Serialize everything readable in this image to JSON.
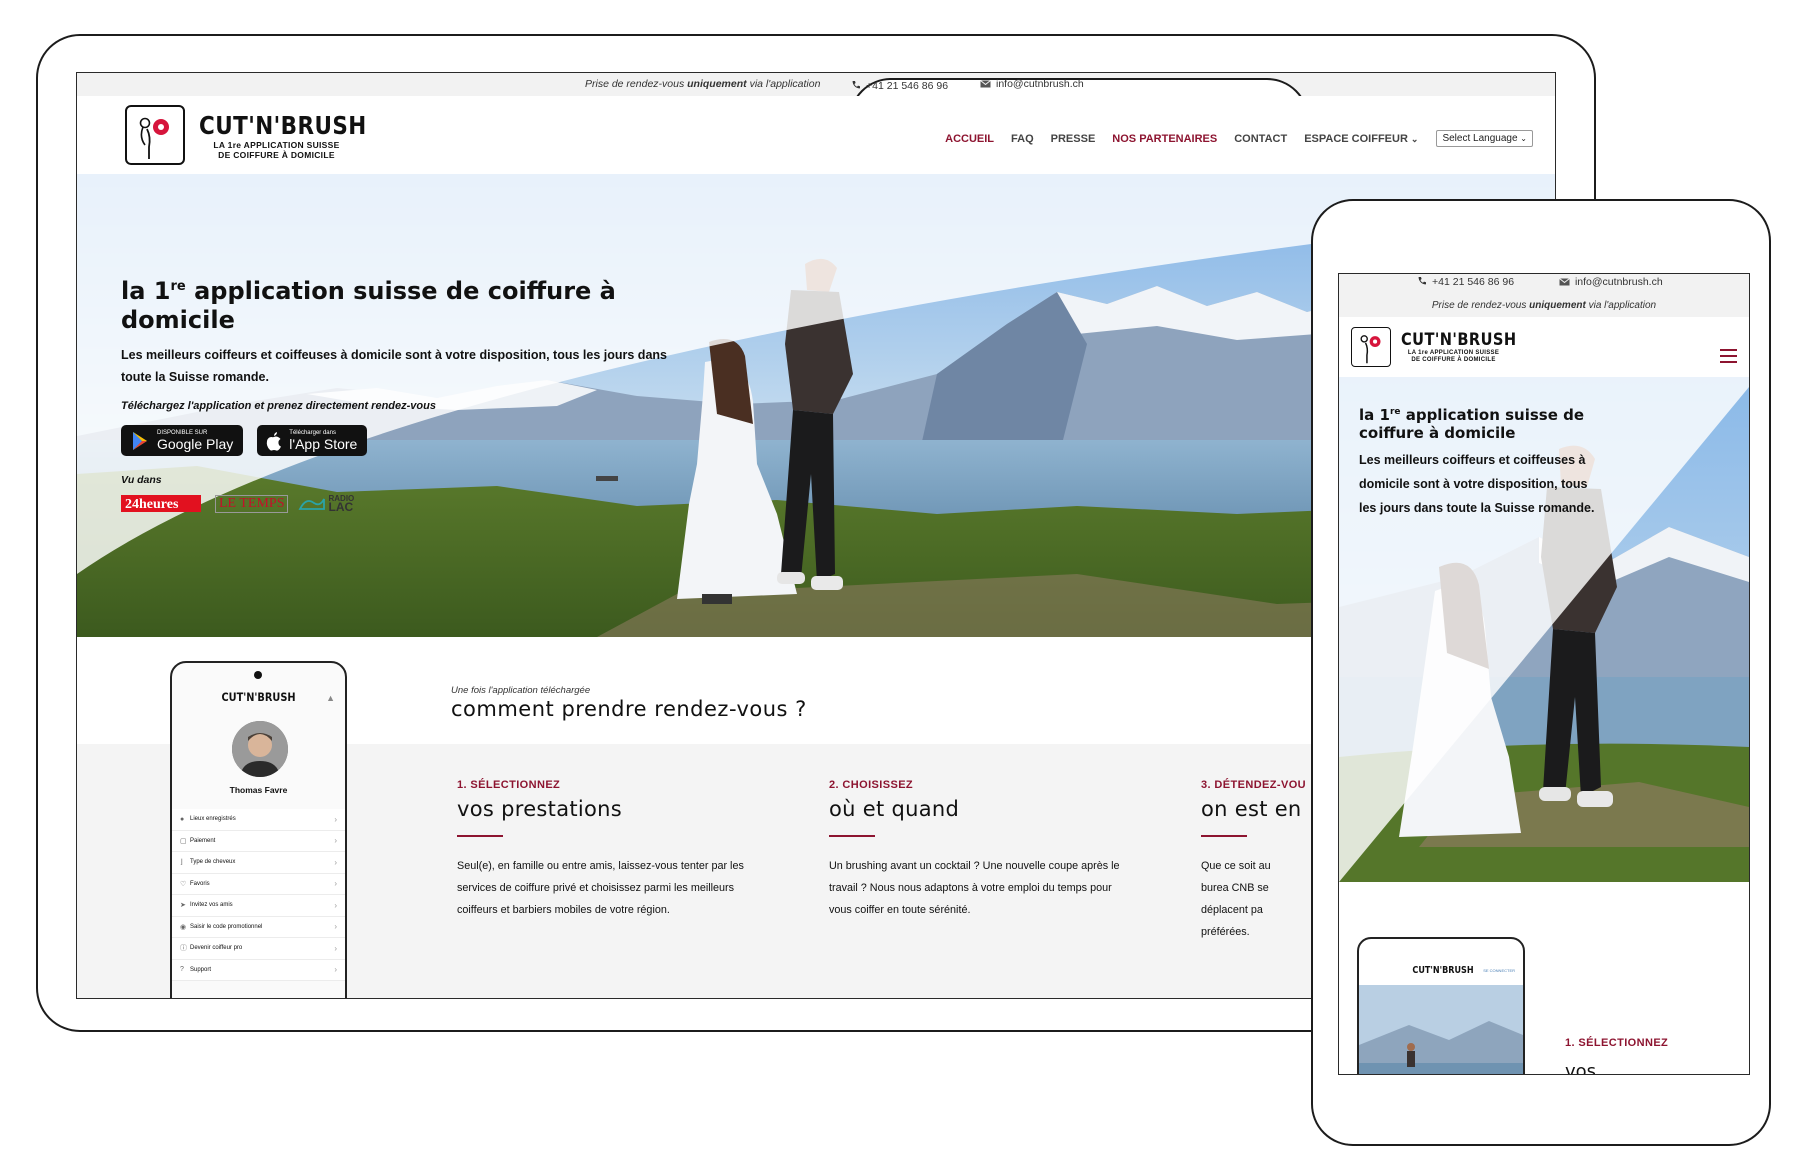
{
  "topbar": {
    "tagline_pre": "Prise de rendez-vous",
    "tagline_bold": "uniquement",
    "tagline_post": "via l'application",
    "phone": "+41 21 546 86 96",
    "email": "info@cutnbrush.ch"
  },
  "brand": {
    "name": "CUT'N'BRUSH",
    "tagline_line1": "LA 1re APPLICATION SUISSE",
    "tagline_line2": "DE COIFFURE À DOMICILE",
    "accent": "#8d1430"
  },
  "nav": {
    "items": [
      "ACCUEIL",
      "FAQ",
      "PRESSE",
      "NOS PARTENAIRES",
      "CONTACT",
      "ESPACE COIFFEUR"
    ],
    "language_select": "Select Language"
  },
  "hero": {
    "title_pre": "la 1",
    "title_sup": "re",
    "title_post": " application suisse de coiffure à domicile",
    "description": "Les meilleurs coiffeurs et coiffeuses à domicile sont à votre disposition, tous les jours dans toute la Suisse romande.",
    "download_cta": "Téléchargez l'application et prenez directement rendez-vous",
    "google_play_small": "DISPONIBLE SUR",
    "google_play_big": "Google Play",
    "app_store_small": "Télécharger dans",
    "app_store_big": "l'App Store",
    "seen_in": "Vu dans",
    "press": [
      "24heures",
      "LE TEMPS",
      "RADIO",
      "LAC"
    ]
  },
  "steps": {
    "kicker": "Une fois l'application téléchargée",
    "title": "comment prendre rendez-vous ?",
    "items": [
      {
        "num": "1. SÉLECTIONNEZ",
        "head": "vos prestations",
        "text": "Seul(e), en famille ou entre amis, laissez-vous tenter par les services de coiffure privé et choisissez parmi les meilleurs coiffeurs et barbiers mobiles de votre région."
      },
      {
        "num": "2. CHOISISSEZ",
        "head": "où et quand",
        "text": "Un brushing avant un cocktail ? Une nouvelle coupe après le travail ? Nous nous adaptons à votre emploi du temps pour vous coiffer en toute sérénité."
      },
      {
        "num": "3. DÉTENDEZ-VOU",
        "head": "on est en",
        "text": "Que ce soit au burea CNB se déplacent pa préférées."
      }
    ]
  },
  "app_screen": {
    "brand": "CUT'N'BRUSH",
    "user_name": "Thomas Favre",
    "menu": [
      "Lieux enregistrés",
      "Paiement",
      "Type de cheveux",
      "Favoris",
      "Invitez vos amis",
      "Saisir le code promotionnel",
      "Devenir coiffeur pro",
      "Support"
    ]
  },
  "mobile": {
    "tagline_pre": "Prise de rendez-vous",
    "tagline_bold": "uniquement",
    "tagline_post": "via l'application",
    "hero_title_pre": "la 1",
    "hero_title_sup": "re",
    "hero_title_post": " application suisse de coiffure à domicile",
    "hero_desc": "Les meilleurs coiffeurs et coiffeuses à domicile sont à votre disposition, tous les jours dans toute la Suisse romande.",
    "app_brand": "CUT'N'BRUSH",
    "app_connect": "SE CONNECTER",
    "step_num": "1. SÉLECTIONNEZ",
    "step_head": "vos"
  }
}
